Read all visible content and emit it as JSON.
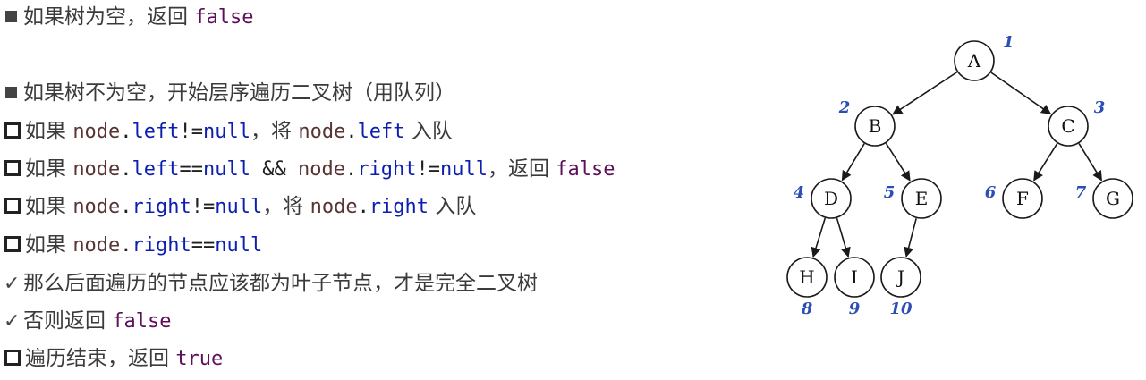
{
  "lines": {
    "l1": {
      "a": "如果树为空，返回 ",
      "b": "false"
    },
    "l2": {
      "a": "如果树不为空，开始层序遍历二叉树（用队列）"
    },
    "l3": {
      "a": "如果 ",
      "b": "node",
      "c": ".",
      "d": "left",
      "e": "!=",
      "f": "null",
      "g": "，将 ",
      "h": "node",
      "i": ".",
      "j": "left",
      "k": " 入队"
    },
    "l4": {
      "a": "如果 ",
      "b": "node",
      "c": ".",
      "d": "left",
      "e": "==",
      "f": "null",
      "g": " && ",
      "h": "node",
      "i": ".",
      "j": "right",
      "k": "!=",
      "l": "null",
      "m": "，返回 ",
      "n": "false"
    },
    "l5": {
      "a": "如果 ",
      "b": "node",
      "c": ".",
      "d": "right",
      "e": "!=",
      "f": "null",
      "g": "，将 ",
      "h": "node",
      "i": ".",
      "j": "right",
      "k": " 入队"
    },
    "l6": {
      "a": "如果 ",
      "b": "node",
      "c": ".",
      "d": "right",
      "e": "==",
      "f": "null"
    },
    "l7": {
      "check": "✓",
      "a": "那么后面遍历的节点应该都为叶子节点，才是完全二叉树"
    },
    "l8": {
      "check": "✓",
      "a": "否则返回 ",
      "b": "false"
    },
    "l9": {
      "a": "遍历结束，返回 ",
      "b": "true"
    }
  },
  "tree": {
    "nodes": [
      {
        "id": "A",
        "label": "A",
        "index": "1"
      },
      {
        "id": "B",
        "label": "B",
        "index": "2"
      },
      {
        "id": "C",
        "label": "C",
        "index": "3"
      },
      {
        "id": "D",
        "label": "D",
        "index": "4"
      },
      {
        "id": "E",
        "label": "E",
        "index": "5"
      },
      {
        "id": "F",
        "label": "F",
        "index": "6"
      },
      {
        "id": "G",
        "label": "G",
        "index": "7"
      },
      {
        "id": "H",
        "label": "H",
        "index": "8"
      },
      {
        "id": "I",
        "label": "I",
        "index": "9"
      },
      {
        "id": "J",
        "label": "J",
        "index": "10"
      }
    ],
    "edges": [
      [
        "A",
        "B"
      ],
      [
        "A",
        "C"
      ],
      [
        "B",
        "D"
      ],
      [
        "B",
        "E"
      ],
      [
        "C",
        "F"
      ],
      [
        "C",
        "G"
      ],
      [
        "D",
        "H"
      ],
      [
        "D",
        "I"
      ],
      [
        "E",
        "J"
      ]
    ],
    "colors": {
      "node_stroke": "#1a1a1a",
      "index": "#2b4db5",
      "edge": "#1a1a1a"
    }
  }
}
